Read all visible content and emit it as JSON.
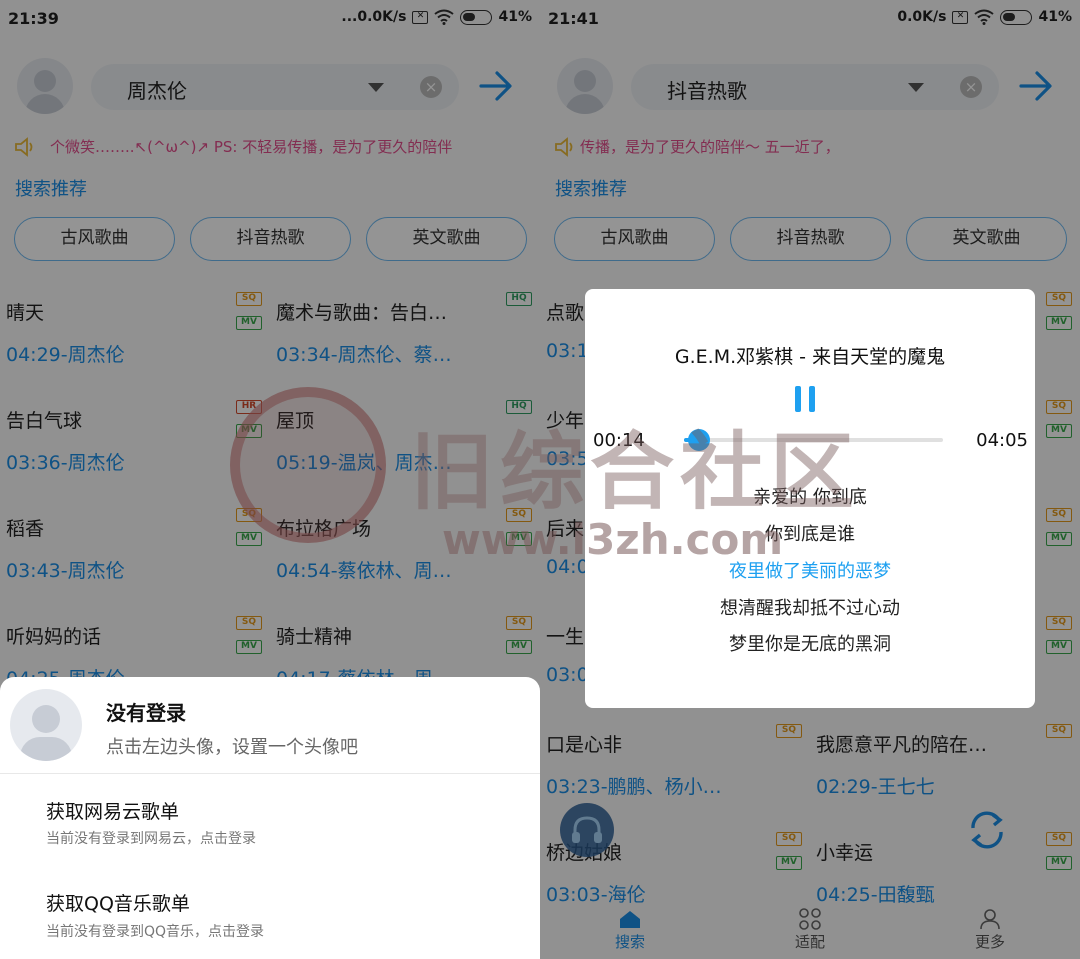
{
  "left": {
    "status": {
      "time": "21:39",
      "net": "...0.0K/s",
      "battery": "41%"
    },
    "search": {
      "query": "周杰伦"
    },
    "marquee": "个微笑……..↖(^ω^)↗ PS:       不轻易传播，是为了更久的陪伴",
    "section_title": "搜索推荐",
    "tags": [
      "古风歌曲",
      "抖音热歌",
      "英文歌曲"
    ],
    "songs": [
      {
        "title": "晴天",
        "duration": "04:29",
        "artist": "周杰伦",
        "badges": [
          "SQ",
          "MV"
        ]
      },
      {
        "title": "魔术与歌曲：告白…",
        "duration": "03:34",
        "artist": "周杰伦、蔡…",
        "badges": [
          "HQ"
        ]
      },
      {
        "title": "告白气球",
        "duration": "03:36",
        "artist": "周杰伦",
        "badges": [
          "HR",
          "MV"
        ]
      },
      {
        "title": "屋顶",
        "duration": "05:19",
        "artist": "温岚、周杰…",
        "badges": [
          "HQ"
        ]
      },
      {
        "title": "稻香",
        "duration": "03:43",
        "artist": "周杰伦",
        "badges": [
          "SQ",
          "MV"
        ]
      },
      {
        "title": "布拉格广场",
        "duration": "04:54",
        "artist": "蔡依林、周…",
        "badges": [
          "SQ",
          "MV"
        ]
      },
      {
        "title": "听妈妈的话",
        "duration": "04:25",
        "artist": "周杰伦",
        "badges": [
          "SQ",
          "MV"
        ]
      },
      {
        "title": "骑士精神",
        "duration": "04:17",
        "artist": "蔡依林、周",
        "badges": [
          "SQ",
          "MV"
        ]
      }
    ],
    "sheet": {
      "name": "没有登录",
      "hint": "点击左边头像，设置一个头像吧",
      "items": [
        {
          "title": "获取网易云歌单",
          "sub": "当前没有登录到网易云，点击登录"
        },
        {
          "title": "获取QQ音乐歌单",
          "sub": "当前没有登录到QQ音乐，点击登录"
        }
      ]
    }
  },
  "right": {
    "status": {
      "time": "21:41",
      "net": "0.0K/s",
      "battery": "41%"
    },
    "search": {
      "query": "抖音热歌"
    },
    "marquee": "传播，是为了更久的陪伴～                    五一近了，",
    "section_title": "搜索推荐",
    "tags": [
      "古风歌曲",
      "抖音热歌",
      "英文歌曲"
    ],
    "songs": [
      {
        "title": "点歌",
        "duration": "03:1",
        "artist": "",
        "badges": [
          "SQ",
          "MV"
        ]
      },
      {
        "title": "",
        "duration": "",
        "artist": "",
        "badges": [
          "SQ",
          "MV"
        ]
      },
      {
        "title": "少年",
        "duration": "03:5",
        "artist": "",
        "badges": [
          "SQ",
          "MV"
        ]
      },
      {
        "title": "",
        "duration": "",
        "artist": "",
        "badges": [
          "SQ",
          "MV"
        ]
      },
      {
        "title": "后来",
        "duration": "04:0",
        "artist": "",
        "badges": [
          "SQ",
          "MV"
        ]
      },
      {
        "title": "",
        "duration": "",
        "artist": "",
        "badges": [
          "SQ",
          "MV"
        ]
      },
      {
        "title": "一生",
        "duration": "03:0",
        "artist": "",
        "badges": [
          "SQ",
          "MV"
        ]
      },
      {
        "title": "",
        "duration": "",
        "artist": "",
        "badges": [
          "SQ",
          "MV"
        ]
      },
      {
        "title": "口是心非",
        "duration": "03:23",
        "artist": "鹏鹏、杨小…",
        "badges": [
          "SQ"
        ]
      },
      {
        "title": "我愿意平凡的陪在…",
        "duration": "02:29",
        "artist": "王七七",
        "badges": [
          "SQ"
        ]
      },
      {
        "title": "桥边姑娘",
        "duration": "03:03",
        "artist": "海伦",
        "badges": [
          "SQ",
          "MV"
        ]
      },
      {
        "title": "小幸运",
        "duration": "04:25",
        "artist": "田馥甄",
        "badges": [
          "SQ",
          "MV"
        ]
      }
    ],
    "player": {
      "title": "G.E.M.邓紫棋 - 来自天堂的魔鬼",
      "current_time": "00:14",
      "total_time": "04:05",
      "progress": 0.057,
      "lyrics": [
        "亲爱的 你到底",
        "你到底是谁",
        "夜里做了美丽的恶梦",
        "想清醒我却抵不过心动",
        "梦里你是无底的黑洞"
      ],
      "active_lyric_index": 2
    },
    "nav": [
      "搜索",
      "适配",
      "更多"
    ]
  },
  "watermark": {
    "name": "旧综合社区",
    "url": "www.i3zh.com"
  },
  "colors": {
    "accent": "#1b8ee6",
    "marquee": "#e24e8c",
    "player_accent": "#1ea0f0"
  },
  "badge_labels": {
    "SQ": "SQ",
    "MV": "MV",
    "HQ": "HQ",
    "HR": "HR"
  }
}
